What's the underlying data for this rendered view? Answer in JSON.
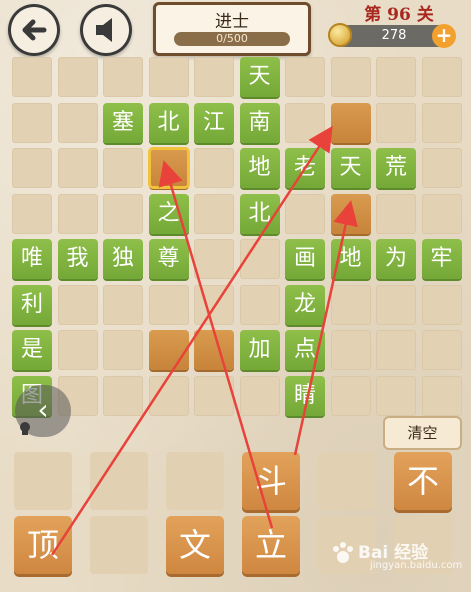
{
  "header": {
    "title": "进士",
    "progress_text": "0/500",
    "progress_fraction": 0.0,
    "level": "第 96 关",
    "coins": "278",
    "plus": "+",
    "back_icon": "back-arrow-icon",
    "sound_icon": "speaker-icon"
  },
  "board": {
    "tiles": [
      {
        "char": "天",
        "row": 0,
        "col": 5
      },
      {
        "char": "塞",
        "row": 1,
        "col": 2
      },
      {
        "char": "北",
        "row": 1,
        "col": 3
      },
      {
        "char": "江",
        "row": 1,
        "col": 4
      },
      {
        "char": "南",
        "row": 1,
        "col": 5
      },
      {
        "char": "地",
        "row": 2,
        "col": 5
      },
      {
        "char": "老",
        "row": 2,
        "col": 6
      },
      {
        "char": "天",
        "row": 2,
        "col": 7
      },
      {
        "char": "荒",
        "row": 2,
        "col": 8
      },
      {
        "char": "之",
        "row": 3,
        "col": 3
      },
      {
        "char": "北",
        "row": 3,
        "col": 5
      },
      {
        "char": "唯",
        "row": 4,
        "col": 0
      },
      {
        "char": "我",
        "row": 4,
        "col": 1
      },
      {
        "char": "独",
        "row": 4,
        "col": 2
      },
      {
        "char": "尊",
        "row": 4,
        "col": 3
      },
      {
        "char": "画",
        "row": 4,
        "col": 6
      },
      {
        "char": "地",
        "row": 4,
        "col": 7
      },
      {
        "char": "为",
        "row": 4,
        "col": 8
      },
      {
        "char": "牢",
        "row": 4,
        "col": 9
      },
      {
        "char": "利",
        "row": 5,
        "col": 0
      },
      {
        "char": "龙",
        "row": 5,
        "col": 6
      },
      {
        "char": "是",
        "row": 6,
        "col": 0
      },
      {
        "char": "加",
        "row": 6,
        "col": 5
      },
      {
        "char": "点",
        "row": 6,
        "col": 6
      },
      {
        "char": "图",
        "row": 7,
        "col": 0
      },
      {
        "char": "睛",
        "row": 7,
        "col": 6
      }
    ],
    "slots": [
      {
        "row": 1,
        "col": 7,
        "selected": false
      },
      {
        "row": 2,
        "col": 3,
        "selected": true
      },
      {
        "row": 3,
        "col": 7,
        "selected": false
      },
      {
        "row": 6,
        "col": 3,
        "selected": false
      },
      {
        "row": 6,
        "col": 4,
        "selected": false
      }
    ]
  },
  "controls": {
    "clear_label": "清空",
    "side_arrow": "‹",
    "hint_icon": "lightbulb-icon"
  },
  "candidates": {
    "top_row": [
      {
        "char": "",
        "col": 0
      },
      {
        "char": "",
        "col": 1
      },
      {
        "char": "",
        "col": 2
      },
      {
        "char": "斗",
        "col": 3
      },
      {
        "char": "",
        "col": 4
      },
      {
        "char": "不",
        "col": 5
      }
    ],
    "bottom_row": [
      {
        "char": "顶",
        "col": 0
      },
      {
        "char": "",
        "col": 1
      },
      {
        "char": "文",
        "col": 2
      },
      {
        "char": "立",
        "col": 3
      },
      {
        "char": "",
        "col": 4
      },
      {
        "char": "",
        "col": 5
      }
    ]
  },
  "watermark": {
    "main": "Bai 经验",
    "sub": "jingyan.baidu.com"
  },
  "colors": {
    "tile_green": "#7fb23e",
    "slot_orange": "#cf8a40",
    "arrow_red": "#e8423a",
    "level_red": "#a8281f"
  }
}
